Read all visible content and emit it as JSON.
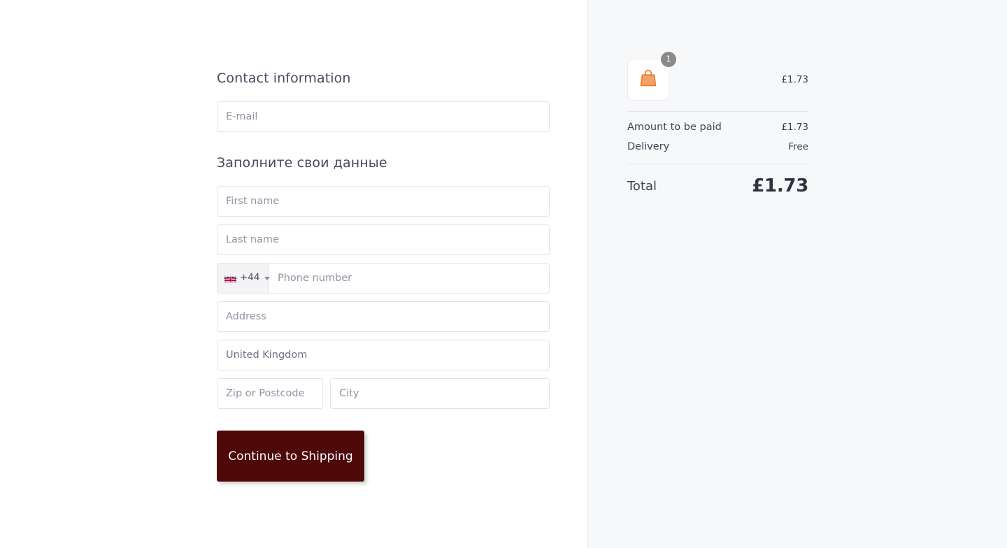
{
  "form": {
    "contact_heading": "Contact information",
    "details_heading": "Заполните свои данные",
    "email_placeholder": "E-mail",
    "email_value": "",
    "first_name_placeholder": "First name",
    "first_name_value": "",
    "last_name_placeholder": "Last name",
    "last_name_value": "",
    "phone": {
      "flag_icon": "uk-flag-icon",
      "dial_code": "+44",
      "dropdown_icon": "chevron-down-icon",
      "placeholder": "Phone number",
      "value": ""
    },
    "address_placeholder": "Address",
    "address_value": "",
    "country_placeholder": "United Kingdom",
    "country_value": "",
    "zip_placeholder": "Zip or Postcode",
    "zip_value": "",
    "city_placeholder": "City",
    "city_value": "",
    "submit_label": "Continue to Shipping"
  },
  "summary": {
    "item": {
      "icon": "shopping-bag-icon",
      "quantity_badge": "1",
      "price": "£1.73"
    },
    "rows": [
      {
        "label": "Amount to be paid",
        "value": "£1.73"
      },
      {
        "label": "Delivery",
        "value": "Free"
      }
    ],
    "total_label": "Total",
    "total_value": "£1.73"
  },
  "colors": {
    "button_background": "#4e0808",
    "button_text": "#ffffff",
    "panel_background": "#f7f8fa",
    "bag_icon": "#f08a3c",
    "badge_background": "#8a8a8a",
    "heading_text": "#454a5f",
    "placeholder_text": "#9195a3",
    "field_border": "#e2e4e9"
  }
}
